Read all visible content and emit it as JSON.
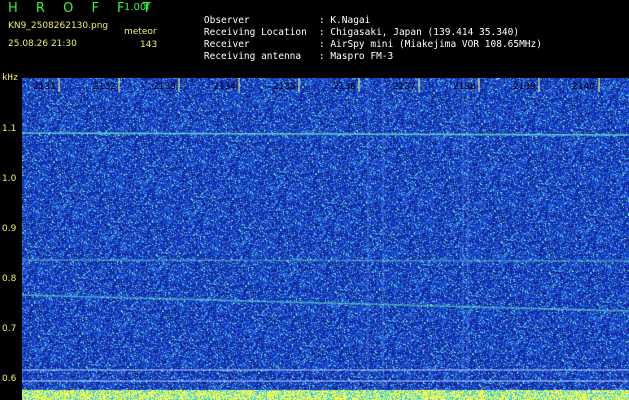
{
  "header": {
    "brand": "H R O F F T",
    "version": "1.00f",
    "filename": "KN9_2508262130.png",
    "timestamp": "25.08.26 21:30",
    "meteor_label": "meteor",
    "meteor_count": "143",
    "info": [
      {
        "key": "Observer",
        "value": ": K.Nagai"
      },
      {
        "key": "Receiving Location",
        "value": ": Chigasaki, Japan (139.414 35.340)"
      },
      {
        "key": "Receiver",
        "value": ": AirSpy mini (Miakejima VOR 108.65MHz)"
      },
      {
        "key": "Receiving antenna",
        "value": ": Maspro FM-3"
      }
    ]
  },
  "spectrogram": {
    "unit": "kHz",
    "y_ticks": [
      "1.1",
      "1.0",
      "0.9",
      "0.8",
      "0.7",
      "0.6"
    ],
    "x_ticks": [
      "2131",
      "2132",
      "2133",
      "2134",
      "2135",
      "2136",
      "2137",
      "2138",
      "2139",
      "2140"
    ],
    "colors": {
      "background": "#10208a",
      "noise": "#2f6fff",
      "signal": "#6ff0c8",
      "grid": "#ffff66",
      "bottom_bar": "#ffff33"
    }
  }
}
